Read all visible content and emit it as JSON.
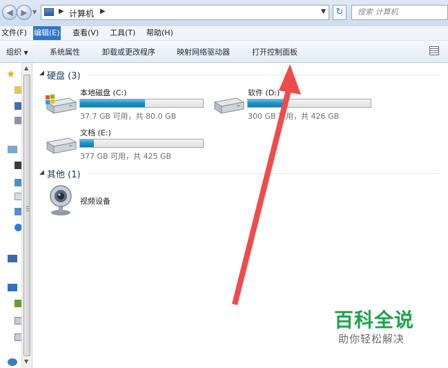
{
  "address_bar": {
    "breadcrumb": "计算机",
    "search_placeholder": "搜索 计算机"
  },
  "menu": {
    "items": [
      "文件(F)",
      "编辑(E)",
      "查看(V)",
      "工具(T)",
      "帮助(H)"
    ],
    "active_index": 1
  },
  "toolbar": {
    "organize": "组织",
    "system_properties": "系统属性",
    "uninstall": "卸载或更改程序",
    "map_drive": "映射网络驱动器",
    "control_panel": "打开控制面板"
  },
  "groups": {
    "hard_disks": {
      "title": "硬盘 (3)",
      "drives": [
        {
          "name": "本地磁盘 (C:)",
          "info": "37.7 GB 可用，共 80.0 GB",
          "used_fraction": 0.53
        },
        {
          "name": "软件 (D:)",
          "info": "300 GB 可用，共 426 GB",
          "used_fraction": 0.3
        },
        {
          "name": "文档 (E:)",
          "info": "377 GB 可用，共 425 GB",
          "used_fraction": 0.11
        }
      ]
    },
    "other": {
      "title": "其他 (1)",
      "items": [
        {
          "name": "视频设备"
        }
      ]
    }
  },
  "watermark": {
    "title": "百科全说",
    "subtitle": "助你轻松解决"
  },
  "colors": {
    "accent": "#2f75c8",
    "annotation_arrow": "#f04b4b",
    "watermark_green": "#1aa34a"
  }
}
